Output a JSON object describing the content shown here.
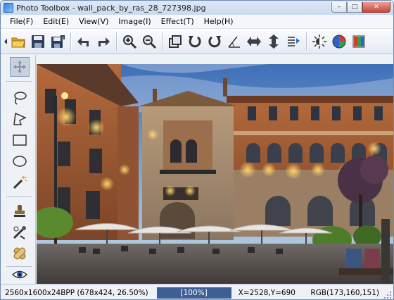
{
  "window": {
    "title": "Photo Toolbox - wall_pack_by_ras_28_727398.jpg",
    "controls": {
      "minimize": "–",
      "maximize": "□",
      "close": "✕"
    }
  },
  "menu": [
    {
      "label": "File(F)"
    },
    {
      "label": "Edit(E)"
    },
    {
      "label": "View(V)"
    },
    {
      "label": "Image(I)"
    },
    {
      "label": "Effect(T)"
    },
    {
      "label": "Help(H)"
    }
  ],
  "toolbar": {
    "buttons": [
      "open-folder-icon",
      "save-icon",
      "save-as-icon",
      "undo-icon",
      "redo-icon",
      "zoom-in-icon",
      "zoom-out-icon",
      "crop-icon",
      "rotate-left-icon",
      "rotate-right-icon",
      "angle-rotate-icon",
      "flip-horizontal-icon",
      "flip-vertical-icon",
      "image-info-icon",
      "brightness-icon",
      "color-balance-icon",
      "rgb-levels-icon"
    ]
  },
  "tools": [
    "move-tool-icon",
    "lasso-tool-icon",
    "polygon-lasso-icon",
    "rectangle-select-icon",
    "ellipse-select-icon",
    "magic-wand-icon",
    "stamp-tool-icon",
    "red-eye-brush-icon",
    "bandage-heal-icon",
    "eye-view-icon"
  ],
  "status": {
    "image_info": "2560x1600x24BPP (678x424, 26.50%)",
    "zoom": "[100%]",
    "coords": "X=2528,Y=690",
    "rgb": "RGB(173,160,151)"
  }
}
